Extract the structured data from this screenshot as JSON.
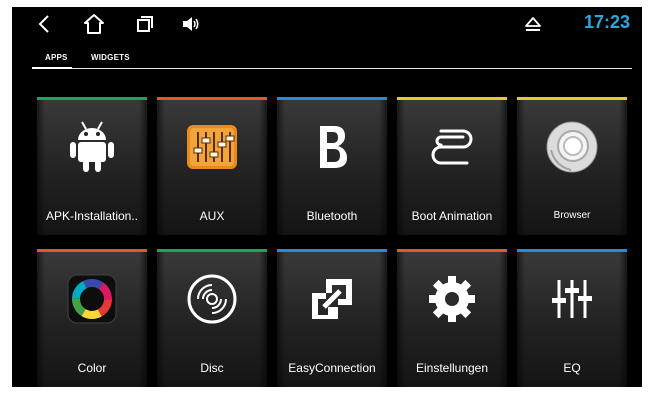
{
  "statusbar": {
    "back_icon": "back-chevron-icon",
    "home_icon": "home-icon",
    "recents_icon": "recent-apps-icon",
    "volume_icon": "volume-icon",
    "eject_icon": "eject-icon",
    "time": "17:23",
    "time_color": "#29a8e0"
  },
  "tabs": [
    {
      "label": "APPS",
      "selected": true
    },
    {
      "label": "WIDGETS",
      "selected": false
    }
  ],
  "apps": [
    {
      "label": "APK-Installation..",
      "icon": "android-icon",
      "accent": "#1fa35a"
    },
    {
      "label": "AUX",
      "icon": "equalizer-sliders-icon",
      "accent": "#e8552b"
    },
    {
      "label": "Bluetooth",
      "icon": "bluetooth-b-icon",
      "accent": "#2a8ad8"
    },
    {
      "label": "Boot Animation",
      "icon": "boot-loop-icon",
      "accent": "#e6c53a"
    },
    {
      "label": "Browser",
      "icon": "browser-disc-icon",
      "accent": "#e6c53a"
    },
    {
      "label": "Color",
      "icon": "color-wheel-icon",
      "accent": "#e8552b"
    },
    {
      "label": "Disc",
      "icon": "disc-icon",
      "accent": "#1fa35a"
    },
    {
      "label": "EasyConnection",
      "icon": "easy-connection-icon",
      "accent": "#2a8ad8"
    },
    {
      "label": "Einstellungen",
      "icon": "gear-icon",
      "accent": "#e8552b"
    },
    {
      "label": "EQ",
      "icon": "eq-sliders-icon",
      "accent": "#2a8ad8"
    }
  ]
}
